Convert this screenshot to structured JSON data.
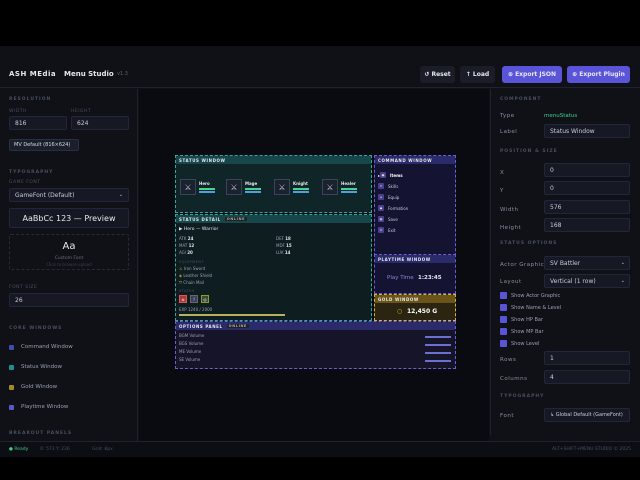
{
  "header": {
    "brand": "ASH MEdia",
    "app_name": "Menu Studio",
    "version": "v1.3",
    "buttons": {
      "reset": "↺ Reset",
      "load": "↑ Load",
      "export_json": "⊕ Export JSON",
      "export_plugin": "⊕ Export Plugin"
    }
  },
  "left": {
    "resolution_title": "RESOLUTION",
    "width_label": "WIDTH",
    "height_label": "HEIGHT",
    "width_value": "816",
    "height_value": "624",
    "preset": "MV Default (816×624)",
    "typography_title": "TYPOGRAPHY",
    "game_font_label": "GAME FONT",
    "game_font_value": "GameFont (Default)",
    "font_preview": "AaBbCc 123 — Preview",
    "custom_font_glyph": "Aa",
    "custom_font_label": "Custom Font",
    "custom_font_hint": "Click to browse upload",
    "font_size_label": "FONT SIZE",
    "font_size_value": "26",
    "core_windows_title": "CORE WINDOWS",
    "windows": [
      {
        "label": "Command Window",
        "color": "#3a4fa8"
      },
      {
        "label": "Status Window",
        "color": "#1d8f8f"
      },
      {
        "label": "Gold Window",
        "color": "#a38a25"
      },
      {
        "label": "Playtime Window",
        "color": "#5b58c8"
      }
    ],
    "breakout_title": "BREAKOUT PANELS"
  },
  "canvas": {
    "status_window": {
      "title": "STATUS WINDOW",
      "actors": [
        "Hero",
        "Mage",
        "Knight",
        "Healer"
      ]
    },
    "status_detail": {
      "title": "STATUS DETAIL",
      "badge": "ONLINE",
      "hero_line": "Hero — Warrior",
      "stats": [
        {
          "k": "ATK",
          "v": "24"
        },
        {
          "k": "DEF",
          "v": "18"
        },
        {
          "k": "MAT",
          "v": "12"
        },
        {
          "k": "MDF",
          "v": "15"
        },
        {
          "k": "AGI",
          "v": "20"
        },
        {
          "k": "LUK",
          "v": "14"
        }
      ],
      "equip_title": "EQUIPMENT",
      "equip": [
        "Iron Sword",
        "Leather Shield",
        "Chain Mail"
      ],
      "states_title": "STATES",
      "exp_text": "EXP 1240 / 2000"
    },
    "command_window": {
      "title": "COMMAND WINDOW",
      "items": [
        "Items",
        "Skills",
        "Equip",
        "Formation",
        "Save",
        "Exit"
      ]
    },
    "playtime_window": {
      "title": "PLAYTIME WINDOW",
      "label": "Play Time",
      "value": "1:23:45"
    },
    "gold_window": {
      "title": "GOLD WINDOW",
      "value": "12,450 G"
    },
    "options_panel": {
      "title": "OPTIONS PANEL",
      "badge": "ONLINE",
      "items": [
        "BGM Volume",
        "BGS Volume",
        "ME Volume",
        "SE Volume"
      ]
    }
  },
  "right": {
    "component_title": "COMPONENT",
    "type_label": "Type",
    "type_value": "menuStatus",
    "label_label": "Label",
    "label_value": "Status Window",
    "position_title": "POSITION & SIZE",
    "x_label": "X",
    "x_value": "0",
    "y_label": "Y",
    "y_value": "0",
    "w_label": "Width",
    "w_value": "576",
    "h_label": "Height",
    "h_value": "168",
    "status_options_title": "STATUS OPTIONS",
    "actor_graphic_label": "Actor Graphic",
    "actor_graphic_value": "SV Battler",
    "layout_label": "Layout",
    "layout_value": "Vertical (1 row)",
    "checks": [
      "Show Actor Graphic",
      "Show Name & Level",
      "Show HP Bar",
      "Show MP Bar",
      "Show Level"
    ],
    "rows_label": "Rows",
    "rows_value": "1",
    "cols_label": "Columns",
    "cols_value": "4",
    "typography_title": "TYPOGRAPHY",
    "font_label": "Font",
    "font_value": "↳ Global Default (GameFont)"
  },
  "statusbar": {
    "state": "● Ready",
    "coords": "X: 573 Y: 236",
    "grid": "Grid: 8px",
    "copyright": "ALT+SHIFT+MENU STUDIO © 2025"
  }
}
